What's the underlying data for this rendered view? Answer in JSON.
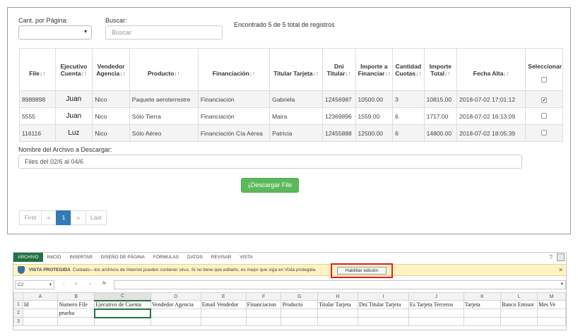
{
  "top": {
    "per_page_label": "Cant. por Página:",
    "search_label": "Buscar:",
    "search_placeholder": "Buscar",
    "found_text": "Encontrado 5 de 5 total de registros",
    "headers": [
      {
        "l1": "",
        "l2": "File"
      },
      {
        "l1": "Ejecutivo",
        "l2": "Cuenta"
      },
      {
        "l1": "Vendedor",
        "l2": "Agencia"
      },
      {
        "l1": "",
        "l2": "Producto"
      },
      {
        "l1": "",
        "l2": "Financiación"
      },
      {
        "l1": "",
        "l2": "Titular Tarjeta"
      },
      {
        "l1": "Dni",
        "l2": "Titular"
      },
      {
        "l1": "Importe a",
        "l2": "Financiar"
      },
      {
        "l1": "Cantidad",
        "l2": "Cuotas"
      },
      {
        "l1": "Importe",
        "l2": "Total"
      },
      {
        "l1": "",
        "l2": "Fecha Alta"
      },
      {
        "l1": "",
        "l2": "Seleccionar"
      }
    ],
    "rows": [
      [
        "8989898",
        "Juan",
        "Nico",
        "Paquete aeroterrestre",
        "Financiación",
        "Gabriela",
        "12456987",
        "10500.00",
        "3",
        "10815.00",
        "2018-07-02 17:01:12",
        true
      ],
      [
        "5555",
        "Juan",
        "Nico",
        "Sólo Tierra",
        "Financiación",
        "Maira",
        "12369896",
        "1559.00",
        "6",
        "1717.00",
        "2018-07-02 16:13:09",
        false
      ],
      [
        "116116",
        "Luz",
        "Nico",
        "Sólo Aéreo",
        "Financiación Cía Aérea",
        "Patricia",
        "12455888",
        "12500.00",
        "6",
        "14800.00",
        "2018-07-02 18:05:39",
        false
      ]
    ],
    "filename_label": "Nombre del Archivo a Descargar:",
    "filename_value": "Files del 02/6 al 04/6",
    "download_label": "Descargar File",
    "pager": {
      "first": "First",
      "prev": "«",
      "page": "1",
      "next": "»",
      "last": "Last"
    }
  },
  "excel": {
    "tabs": [
      "ARCHIVO",
      "INICIO",
      "INSERTAR",
      "DISEÑO DE PÁGINA",
      "FÓRMULAS",
      "DATOS",
      "REVISAR",
      "VISTA"
    ],
    "protected_title": "VISTA PROTEGIDA",
    "protected_msg": "Cuidado—los archivos de Internet pueden contener virus. Si no tiene que editarlo, es mejor que siga en Vista protegida.",
    "enable_btn": "Habilitar edición",
    "cell_ref": "C2",
    "fx": "fx",
    "col_letters": [
      "A",
      "B",
      "C",
      "D",
      "E",
      "F",
      "G",
      "H",
      "I",
      "J",
      "K",
      "L",
      "M"
    ],
    "row1": [
      "Id",
      "Numero File",
      "Ejecutivo de Cuenta",
      "Vendedor Agencia",
      "Email Vendedor",
      "Financiacion",
      "Producto",
      "Titular Tarjeta",
      "Dni Titular Tarjeta",
      "Es Tarjeta Terceros",
      "Tarjeta",
      "Banco Emisor",
      "Mes Ve"
    ],
    "row2": [
      "",
      "prueba",
      "",
      "",
      "",
      "",
      "",
      "",
      "",
      "",
      "",
      "",
      ""
    ],
    "row_numbers": [
      "1",
      "2",
      "3"
    ]
  }
}
